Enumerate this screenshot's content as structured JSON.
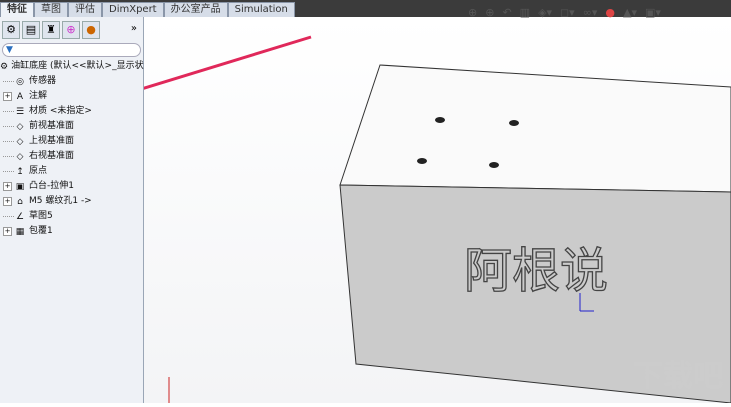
{
  "tabs": [
    "特征",
    "草图",
    "评估",
    "DimXpert",
    "办公室产品",
    "Simulation"
  ],
  "panel": {
    "more": "»",
    "filter_icon": "▼",
    "tree": [
      {
        "label": "油缸底座 (默认<<默认>_显示状",
        "icon": "part-icon",
        "exp": false,
        "root": true
      },
      {
        "label": "传感器",
        "icon": "sensor-icon",
        "exp": false
      },
      {
        "label": "注解",
        "icon": "annotation-icon",
        "exp": true
      },
      {
        "label": "材质 <未指定>",
        "icon": "material-icon",
        "exp": false
      },
      {
        "label": "前视基准面",
        "icon": "plane-icon",
        "exp": false
      },
      {
        "label": "上视基准面",
        "icon": "plane-icon",
        "exp": false
      },
      {
        "label": "右视基准面",
        "icon": "plane-icon",
        "exp": false
      },
      {
        "label": "原点",
        "icon": "origin-icon",
        "exp": false
      },
      {
        "label": "凸台-拉伸1",
        "icon": "extrude-icon",
        "exp": true
      },
      {
        "label": "M5 螺纹孔1 ->",
        "icon": "hole-icon",
        "exp": true
      },
      {
        "label": "草图5",
        "icon": "sketch-icon",
        "exp": false
      },
      {
        "label": "包覆1",
        "icon": "wrap-icon",
        "exp": true
      }
    ]
  },
  "viewport": {
    "engraved_text": "阿根说",
    "watermark": "下载吧",
    "arrow_color": "#e0285a"
  }
}
